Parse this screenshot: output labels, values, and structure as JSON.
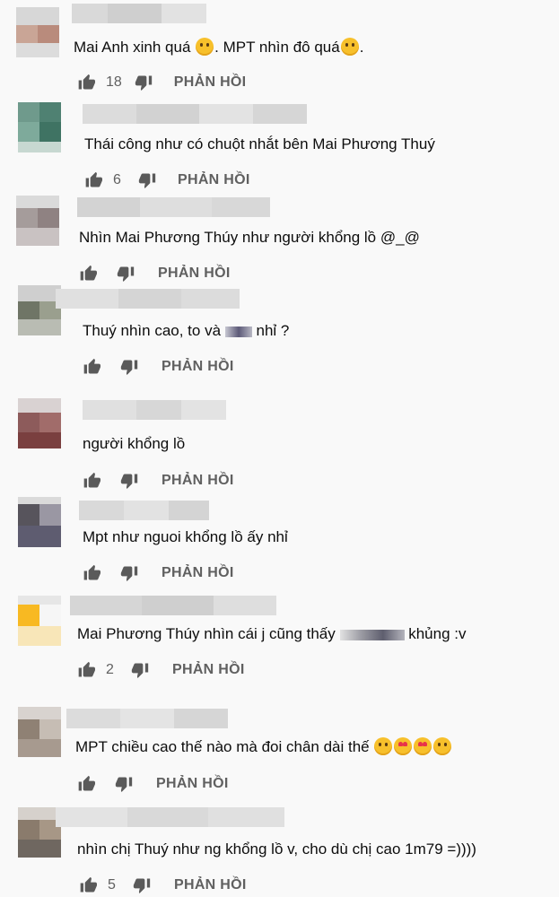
{
  "reply_label": "PHẢN HỒI",
  "icons": {
    "like": "thumbs-up-icon",
    "dislike": "thumbs-down-icon"
  },
  "comments": [
    {
      "text_a": "Mai Anh xinh quá ",
      "text_b": ". MPT nhìn đô quá",
      "text_c": ".",
      "likes": "18"
    },
    {
      "text_a": "Thái công như có chuột nhắt bên Mai Phương Thuý",
      "likes": "6"
    },
    {
      "text_a": "Nhìn Mai Phương Thúy như người khổng lồ @_@",
      "likes": ""
    },
    {
      "text_a": "Thuý nhìn cao, to và ",
      "text_b": " nhỉ ?",
      "likes": ""
    },
    {
      "text_a": "người khổng lồ",
      "likes": ""
    },
    {
      "text_a": "Mpt như nguoi khổng lồ ấy nhỉ",
      "likes": ""
    },
    {
      "text_a": "Mai Phương Thúy nhìn cái j cũng thấy ",
      "text_b": " khủng :v",
      "likes": "2"
    },
    {
      "text_a": "MPT chiều cao thế nào mà đoi chân dài thế ",
      "likes": ""
    },
    {
      "text_a": "nhìn chị Thuý như ng khổng lồ v, cho dù chị cao 1m79 =))))",
      "likes": "5"
    }
  ]
}
